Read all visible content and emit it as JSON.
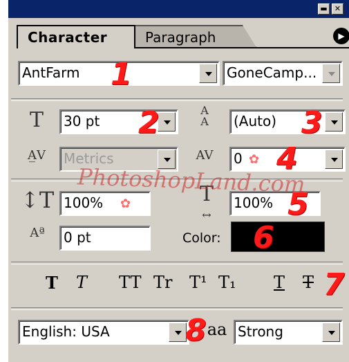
{
  "tabs": {
    "character": "Character",
    "paragraph": "Paragraph"
  },
  "font": {
    "family": "AntFarm",
    "style": "GoneCamp..."
  },
  "size": {
    "value": "30 pt"
  },
  "leading": {
    "value": "(Auto)"
  },
  "kerning": {
    "value": "Metrics"
  },
  "tracking": {
    "value": "0"
  },
  "vertical_scale": {
    "value": "100%"
  },
  "horizontal_scale": {
    "value": "100%"
  },
  "baseline_shift": {
    "value": "0 pt"
  },
  "color": {
    "label": "Color:",
    "value": "#000000"
  },
  "style_buttons": [
    "T",
    "T",
    "TT",
    "Tr",
    "T¹",
    "T₁",
    "T",
    "T"
  ],
  "language": {
    "value": "English: USA"
  },
  "antialias": {
    "icon_text": "aa",
    "value": "Strong"
  },
  "annotations": [
    "1",
    "2",
    "3",
    "4",
    "5",
    "6",
    "7",
    "8"
  ],
  "watermark": "PhotoshopLand.com",
  "colors": {
    "titlebar": "#0a246a",
    "panel": "#d4d0c8",
    "annotation": "#ff1a1a"
  }
}
